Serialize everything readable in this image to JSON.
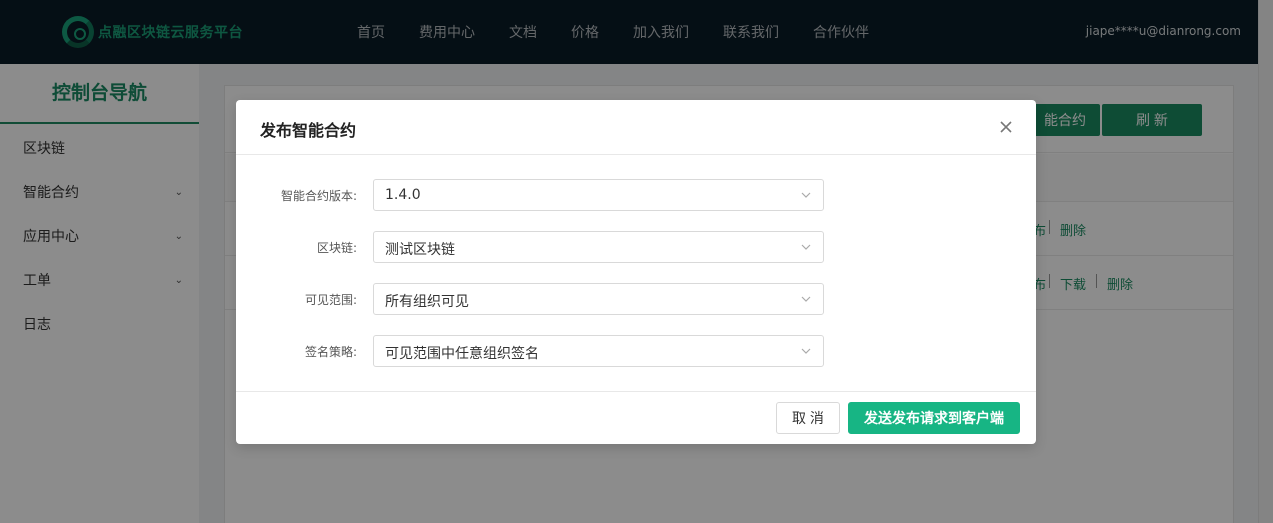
{
  "header": {
    "logo_text": "点融区块链云服务平台",
    "nav": [
      "首页",
      "费用中心",
      "文档",
      "价格",
      "加入我们",
      "联系我们",
      "合作伙伴"
    ],
    "user_email": "jiape****u@dianrong.com"
  },
  "sidebar": {
    "title": "控制台导航",
    "items": [
      {
        "label": "区块链",
        "has_children": false
      },
      {
        "label": "智能合约",
        "has_children": true
      },
      {
        "label": "应用中心",
        "has_children": true
      },
      {
        "label": "工单",
        "has_children": true
      },
      {
        "label": "日志",
        "has_children": false
      }
    ]
  },
  "main": {
    "buttons": {
      "publish_partial": "能合约",
      "refresh": "刷 新"
    },
    "rows": [
      {
        "actions": [
          "布",
          "删除"
        ]
      },
      {
        "actions": [
          "布",
          "下载",
          "删除"
        ]
      }
    ]
  },
  "modal": {
    "title": "发布智能合约",
    "fields": [
      {
        "label": "智能合约版本:",
        "value": "1.4.0"
      },
      {
        "label": "区块链:",
        "value": "测试区块链"
      },
      {
        "label": "可见范围:",
        "value": "所有组织可见"
      },
      {
        "label": "签名策略:",
        "value": "可见范围中任意组织签名"
      }
    ],
    "cancel_label": "取 消",
    "submit_label": "发送发布请求到客户端"
  },
  "colors": {
    "brand_green": "#1a8a62",
    "primary_button": "#17b584",
    "topbar_bg": "#0a1c27"
  }
}
